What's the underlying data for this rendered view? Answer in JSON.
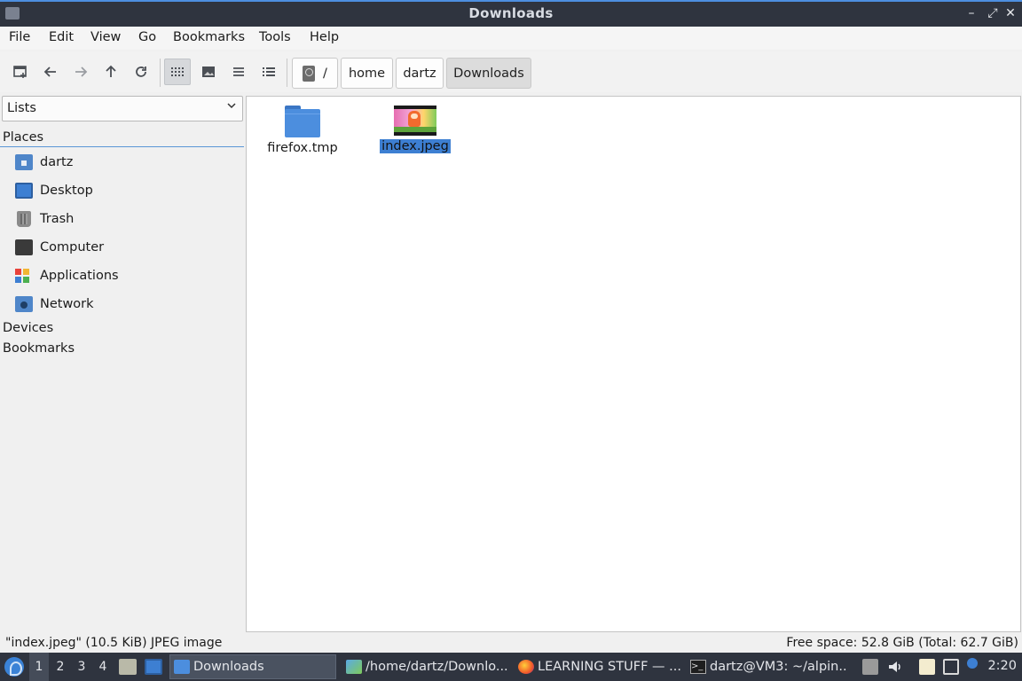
{
  "window": {
    "title": "Downloads",
    "controls": {
      "minimize": "–",
      "maximize": "⤢",
      "close": "✕"
    }
  },
  "menu": [
    "File",
    "Edit",
    "View",
    "Go",
    "Bookmarks",
    "Tools",
    "Help"
  ],
  "toolbar": {
    "buttons": [
      "new-tab-icon",
      "back-arrow-icon",
      "forward-arrow-icon",
      "up-arrow-icon",
      "reload-icon",
      "icon-view-icon",
      "thumbnail-view-icon",
      "compact-view-icon",
      "detailed-list-view-icon"
    ],
    "active_view": "icon-view"
  },
  "breadcrumb": [
    "/",
    "home",
    "dartz",
    "Downloads"
  ],
  "sidebar": {
    "selector": "Lists",
    "sections": {
      "places": "Places",
      "devices": "Devices",
      "bookmarks": "Bookmarks"
    },
    "places": [
      {
        "label": "dartz",
        "icon": "home-folder-icon"
      },
      {
        "label": "Desktop",
        "icon": "desktop-icon"
      },
      {
        "label": "Trash",
        "icon": "trash-icon"
      },
      {
        "label": "Computer",
        "icon": "computer-icon"
      },
      {
        "label": "Applications",
        "icon": "applications-icon"
      },
      {
        "label": "Network",
        "icon": "network-icon"
      }
    ]
  },
  "files": [
    {
      "name": "firefox.tmp",
      "type": "folder",
      "selected": false
    },
    {
      "name": "index.jpeg",
      "type": "image",
      "selected": true
    }
  ],
  "status": {
    "left": "\"index.jpeg\" (10.5 KiB) JPEG image",
    "right": "Free space: 52.8 GiB (Total: 62.7 GiB)"
  },
  "taskbar": {
    "workspaces": [
      "1",
      "2",
      "3",
      "4"
    ],
    "active_workspace": "1",
    "tasks": [
      {
        "label": "Downloads",
        "icon": "folder-icon",
        "active": true
      },
      {
        "label": "/home/dartz/Downlo...",
        "icon": "image-viewer-icon",
        "active": false
      },
      {
        "label": "LEARNING STUFF — ...",
        "icon": "firefox-icon",
        "active": false
      },
      {
        "label": "dartz@VM3: ~/alpin...",
        "icon": "terminal-icon",
        "active": false
      }
    ],
    "clock": "2:20"
  },
  "colors": {
    "accent": "#3d7fd2",
    "titlebar": "#2f343f",
    "selection": "#3d7fd2"
  }
}
